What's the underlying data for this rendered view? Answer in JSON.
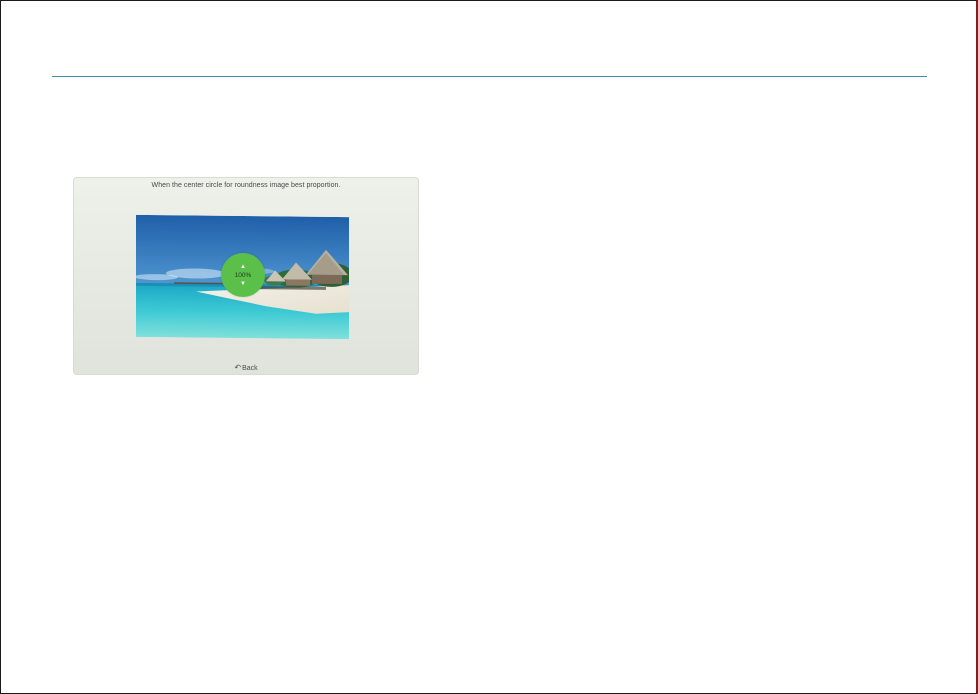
{
  "screen": {
    "instruction": "When the center circle for roundness image best proportion.",
    "zoom": {
      "value": "100%",
      "up_icon": "triangle-up-icon",
      "down_icon": "triangle-down-icon",
      "color": "#5ac04a"
    },
    "back_label": "Back",
    "back_icon": "return-arrow-icon",
    "photo": "tropical-beach-image"
  },
  "colors": {
    "rule": "#3f8fa8",
    "frame_right": "#8a1c1c"
  }
}
